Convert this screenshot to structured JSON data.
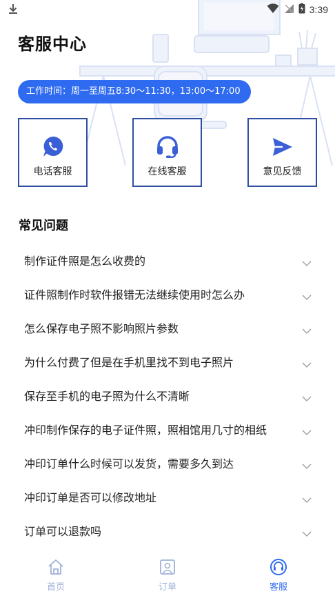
{
  "status_bar": {
    "time": "3:39"
  },
  "page": {
    "title": "客服中心"
  },
  "hours": {
    "text": "工作时间：周一至周五8:30～11:30，13:00～17:00"
  },
  "cards": [
    {
      "label": "电话客服",
      "icon": "phone-icon"
    },
    {
      "label": "在线客服",
      "icon": "headset-icon"
    },
    {
      "label": "意见反馈",
      "icon": "send-icon"
    }
  ],
  "faq": {
    "title": "常见问题",
    "items": [
      {
        "question": "制作证件照是怎么收费的"
      },
      {
        "question": "证件照制作时软件报错无法继续使用时怎么办"
      },
      {
        "question": "怎么保存电子照不影响照片参数"
      },
      {
        "question": "为什么付费了但是在手机里找不到电子照片"
      },
      {
        "question": "保存至手机的电子照为什么不清晰"
      },
      {
        "question": "冲印制作保存的电子证件照，照相馆用几寸的相纸"
      },
      {
        "question": "冲印订单什么时候可以发货，需要多久到达"
      },
      {
        "question": "冲印订单是否可以修改地址"
      },
      {
        "question": "订单可以退款吗"
      }
    ]
  },
  "nav": {
    "items": [
      {
        "label": "首页",
        "icon": "home-icon",
        "active": false
      },
      {
        "label": "订单",
        "icon": "orders-icon",
        "active": false
      },
      {
        "label": "客服",
        "icon": "customer-service-icon",
        "active": true
      }
    ]
  },
  "colors": {
    "accent": "#2f6bf0",
    "card_border": "#2f4fa3",
    "inactive_nav": "#9fb0d8"
  }
}
